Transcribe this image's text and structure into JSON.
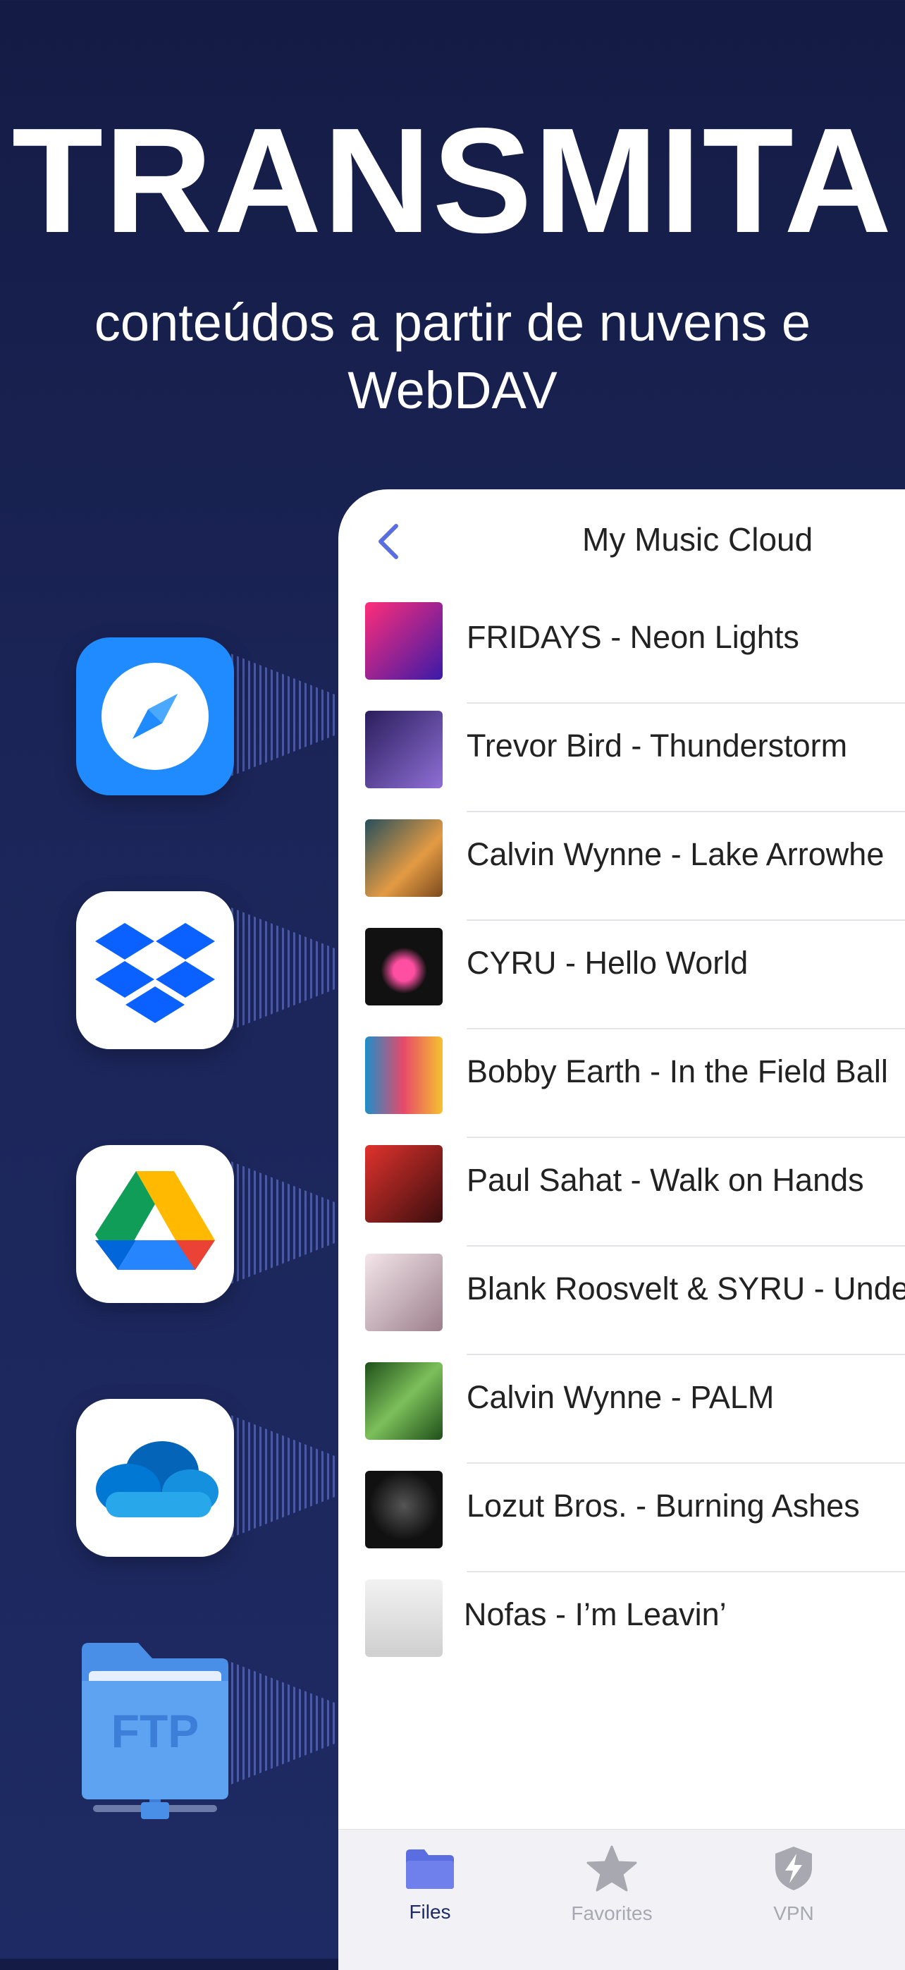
{
  "hero": {
    "title": "TRANSMITA",
    "subtitle_line1": "conteúdos a partir de nuvens e",
    "subtitle_line2": "WebDAV"
  },
  "services": [
    {
      "name": "safari",
      "icon": "compass-icon"
    },
    {
      "name": "dropbox",
      "icon": "dropbox-icon"
    },
    {
      "name": "google-drive",
      "icon": "google-drive-icon"
    },
    {
      "name": "onedrive",
      "icon": "onedrive-icon"
    },
    {
      "name": "ftp",
      "icon": "ftp-server-icon",
      "label": "FTP"
    }
  ],
  "screen": {
    "title": "My Music Cloud",
    "back_icon": "chevron-left-icon",
    "tracks": [
      {
        "title": "FRIDAYS - Neon Lights",
        "cover_color": "#c2185b"
      },
      {
        "title": "Trevor Bird - Thunderstorm",
        "cover_color": "#5a3e9c"
      },
      {
        "title": "Calvin Wynne - Lake Arrowhe",
        "cover_color": "#d0893a"
      },
      {
        "title": "CYRU - Hello World",
        "cover_color": "#111111"
      },
      {
        "title": "Bobby Earth - In the Field Ball",
        "cover_color": "#e0a020"
      },
      {
        "title": "Paul Sahat - Walk on Hands",
        "cover_color": "#b31d1d"
      },
      {
        "title": "Blank Roosvelt & SYRU - Unde",
        "cover_color": "#c7a9b6"
      },
      {
        "title": "Calvin Wynne - PALM",
        "cover_color": "#2e6b2a"
      },
      {
        "title": "Lozut Bros. - Burning Ashes",
        "cover_color": "#1a1a1a"
      },
      {
        "title": "Nofas - I’m Leavin’",
        "cover_color": "#d9d9d9"
      }
    ],
    "tabs": [
      {
        "label": "Files",
        "icon": "folder-icon",
        "active": true
      },
      {
        "label": "Favorites",
        "icon": "star-icon",
        "active": false
      },
      {
        "label": "VPN",
        "icon": "shield-bolt-icon",
        "active": false
      }
    ]
  },
  "colors": {
    "background": "#1b2558",
    "accent": "#5b6ee1",
    "inactive": "#a8a8b0"
  }
}
